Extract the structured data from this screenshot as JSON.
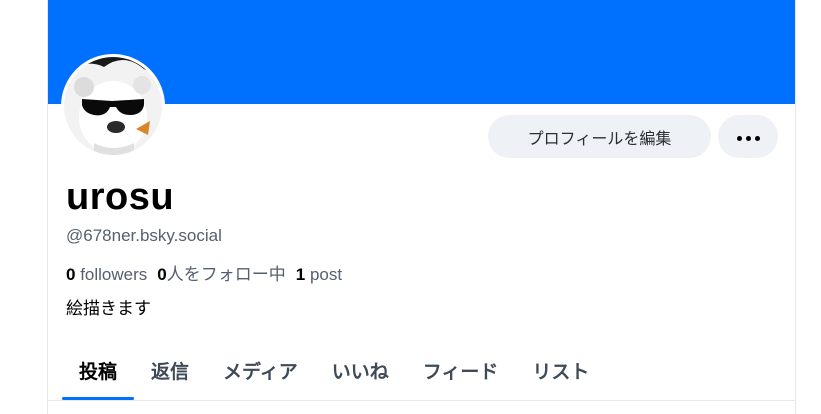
{
  "profile": {
    "display_name": "urosu",
    "handle": "@678ner.bsky.social",
    "followers_count": "0",
    "followers_label": "followers",
    "following_count": "0",
    "following_label": "人をフォロー中",
    "posts_count": "1",
    "posts_label": "post",
    "bio": "絵描きます"
  },
  "actions": {
    "edit_profile_label": "プロフィールを編集",
    "more_icon": "ellipsis-icon"
  },
  "tabs": [
    {
      "label": "投稿",
      "active": true
    },
    {
      "label": "返信"
    },
    {
      "label": "メディア"
    },
    {
      "label": "いいね"
    },
    {
      "label": "フィード"
    },
    {
      "label": "リスト"
    }
  ],
  "colors": {
    "banner": "#0070ff",
    "accent": "#0070ff",
    "button_bg": "#eef1f5",
    "muted_text": "#55606f"
  }
}
